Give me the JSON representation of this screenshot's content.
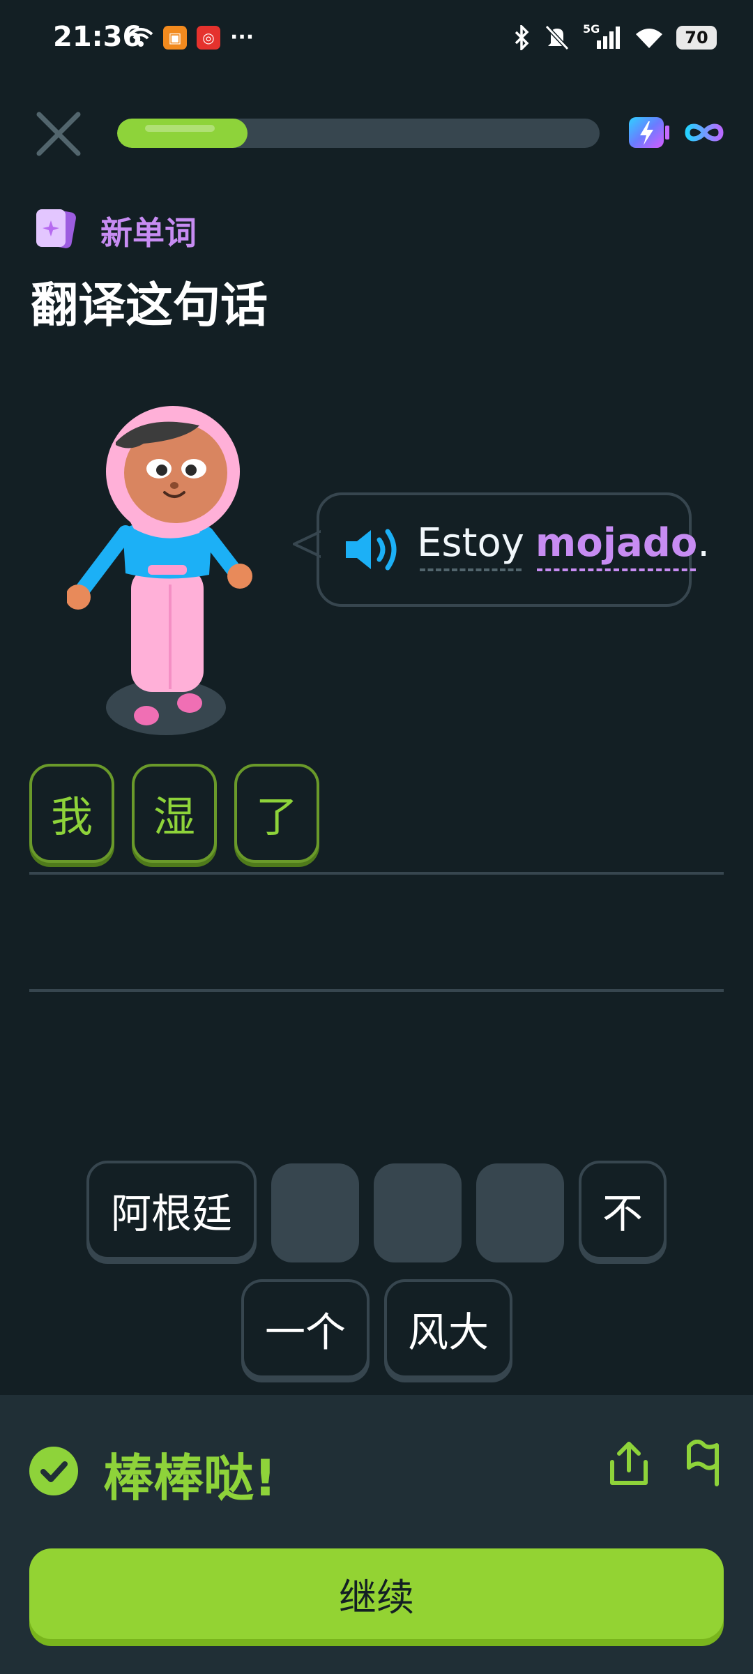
{
  "status_bar": {
    "time": "21:36",
    "more": "···",
    "battery": "70",
    "network": "5G",
    "icons": [
      "wifi-icon",
      "app-notification-icon",
      "netease-music-icon",
      "bluetooth-icon",
      "mute-icon",
      "signal-icon",
      "wifi-icon",
      "battery-icon"
    ]
  },
  "header": {
    "progress": 0.27,
    "icons": [
      "close-icon",
      "energy-icon",
      "infinity-icon"
    ]
  },
  "lesson": {
    "badge_label": "新单词",
    "prompt": "翻译这句话",
    "sentence_plain": "Estoy",
    "sentence_new": "mojado",
    "sentence_end": "."
  },
  "answer": {
    "tiles": [
      "我",
      "湿",
      "了"
    ]
  },
  "word_bank": {
    "row1": [
      "阿根廷",
      "不"
    ],
    "row2": [
      "一个",
      "风大"
    ]
  },
  "feedback": {
    "message": "棒棒哒!",
    "continue_label": "继续"
  },
  "colors": {
    "background": "#131f24",
    "accent_green": "#93d333",
    "new_word_purple": "#c78cf2",
    "tile_border": "#37464f"
  }
}
